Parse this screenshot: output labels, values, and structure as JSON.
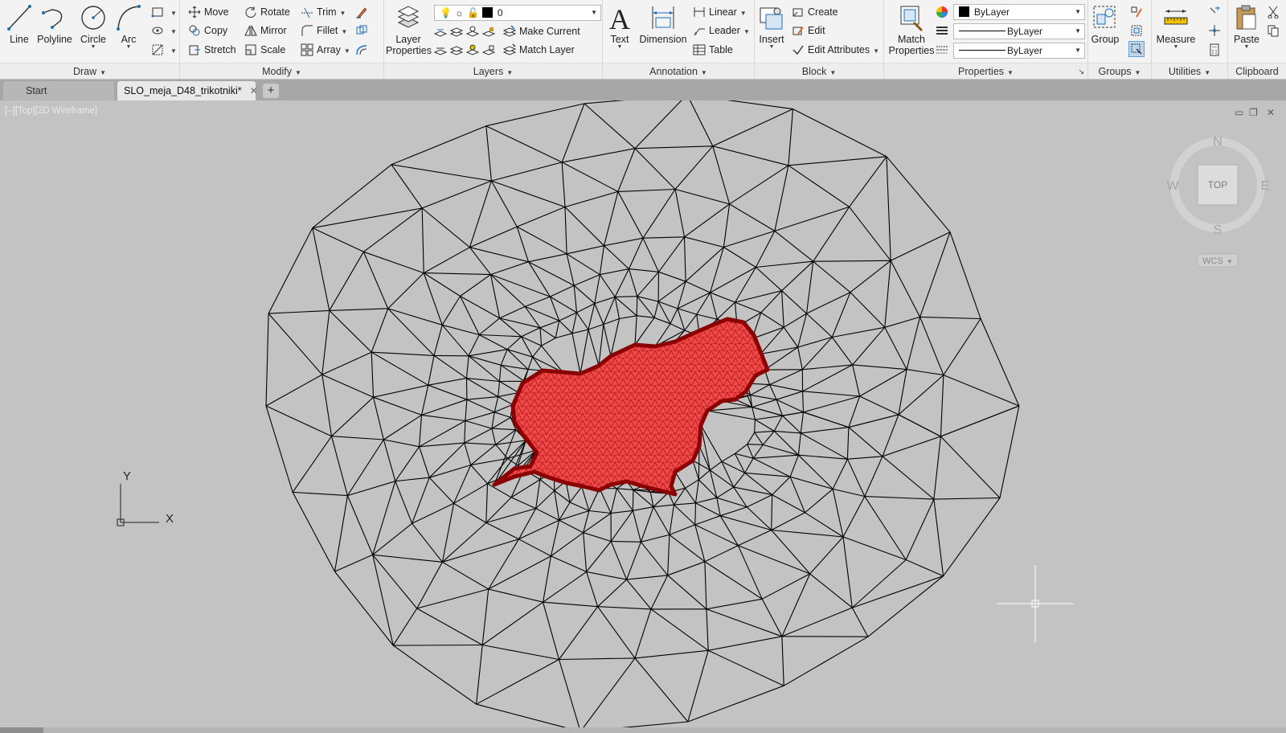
{
  "draw": {
    "title": "Draw",
    "line": "Line",
    "polyline": "Polyline",
    "circle": "Circle",
    "arc": "Arc"
  },
  "modify": {
    "title": "Modify",
    "move": "Move",
    "rotate": "Rotate",
    "trim": "Trim",
    "copy": "Copy",
    "mirror": "Mirror",
    "fillet": "Fillet",
    "stretch": "Stretch",
    "scale": "Scale",
    "array": "Array"
  },
  "layers": {
    "title": "Layers",
    "layer_properties": "Layer Properties",
    "current_layer": "0",
    "make_current": "Make Current",
    "match_layer": "Match Layer"
  },
  "annotation": {
    "title": "Annotation",
    "text": "Text",
    "dimension": "Dimension",
    "linear": "Linear",
    "leader": "Leader",
    "table": "Table"
  },
  "block": {
    "title": "Block",
    "insert": "Insert",
    "create": "Create",
    "edit": "Edit",
    "edit_attributes": "Edit Attributes"
  },
  "properties": {
    "title": "Properties",
    "match_properties": "Match Properties",
    "color": "ByLayer",
    "linetype": "ByLayer",
    "lineweight": "ByLayer"
  },
  "groups": {
    "title": "Groups",
    "group": "Group"
  },
  "utilities": {
    "title": "Utilities",
    "measure": "Measure"
  },
  "clipboard": {
    "title": "Clipboard",
    "paste": "Paste"
  },
  "tabs": {
    "start": "Start",
    "drawing": "SLO_meja_D48_trikotniki*"
  },
  "viewport": {
    "label": "[–][Top][2D Wireframe]"
  },
  "viewcube": {
    "top": "TOP",
    "n": "N",
    "s": "S",
    "e": "E",
    "w": "W",
    "wcs": "WCS"
  },
  "ucs": {
    "x": "X",
    "y": "Y"
  },
  "colors": {
    "ribbon_bg": "#f3f3f3",
    "canvas_bg": "#c3c3c3",
    "mesh_line": "#000000",
    "region_fill": "#f04848",
    "region_border": "#8b0000",
    "accent": "#1b6fb8"
  }
}
